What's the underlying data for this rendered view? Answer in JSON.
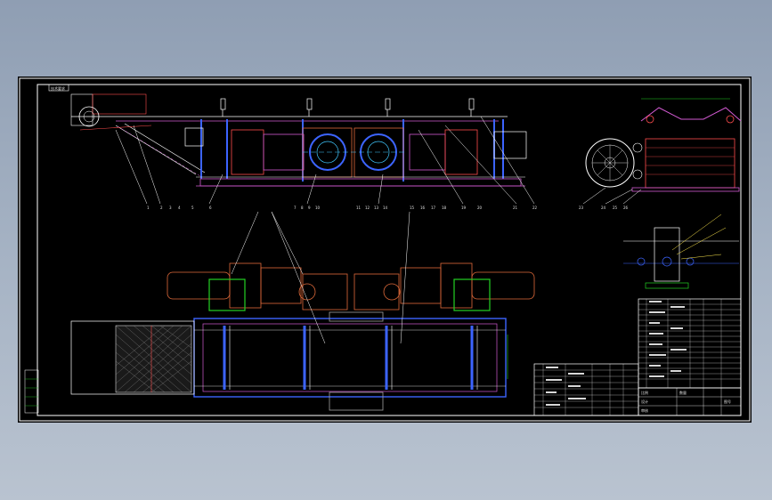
{
  "drawing": {
    "title_tag": "技术要求",
    "colors": {
      "frame": "#ffffff",
      "structure": "#d25ad2",
      "shaft_blue": "#3c64ff",
      "frame_red": "#ff4d4d",
      "guard_green": "#23d223",
      "support_grey": "#a0a0a0",
      "gear_orange": "#e06a3a",
      "axis_cyan": "#40c8ff",
      "leader_yellow": "#ffe84d"
    },
    "balloons_top": [
      "1",
      "2",
      "3",
      "4",
      "5",
      "6",
      "7",
      "8",
      "9",
      "10",
      "11",
      "12",
      "13",
      "14",
      "15",
      "16",
      "17",
      "18",
      "19",
      "20",
      "21",
      "22"
    ],
    "balloons_side": [
      "23",
      "24",
      "25",
      "26"
    ],
    "title_block": {
      "row1": [
        "比例",
        "",
        "数量",
        ""
      ],
      "row2": [
        "设计",
        "",
        "",
        "图号"
      ],
      "row3": [
        "审核",
        "",
        "",
        ""
      ]
    }
  }
}
